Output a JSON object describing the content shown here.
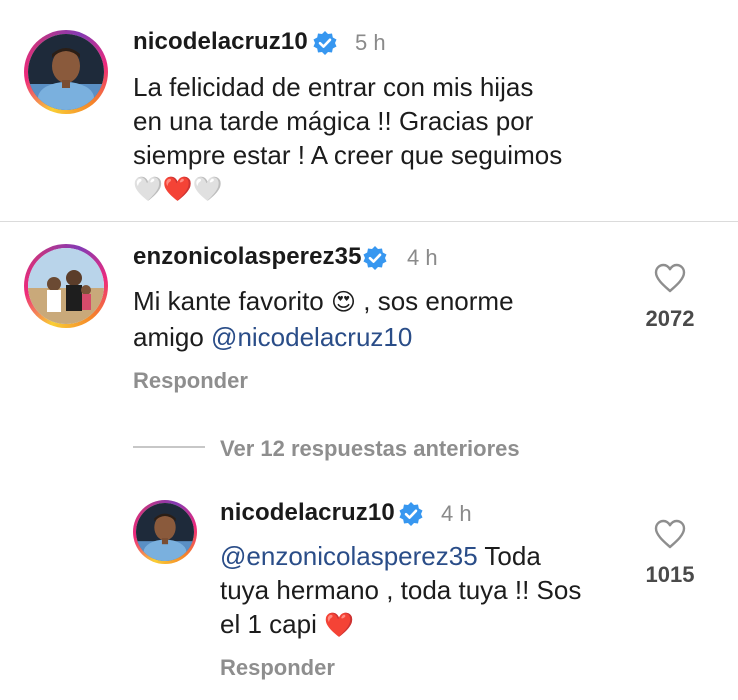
{
  "comments": [
    {
      "username": "nicodelacruz10",
      "time": "5 h",
      "lines": [
        "La felicidad de entrar con mis hijas",
        "en una tarde mágica !! Gracias por",
        "siempre estar ! A creer que seguimos"
      ],
      "emoji_line": "🤍❤️🤍"
    },
    {
      "username": "enzonicolasperez35",
      "time": "4 h",
      "line1_before": "Mi kante favorito",
      "line1_emoji": "😍",
      "line1_after": ", sos enorme",
      "line2_before": "amigo ",
      "mention": "@nicodelacruz10",
      "likes": "2072",
      "reply_label": "Responder"
    }
  ],
  "view_replies_label": "Ver 12 respuestas anteriores",
  "reply": {
    "username": "nicodelacruz10",
    "time": "4 h",
    "mention": "@enzonicolasperez35",
    "line1_after": " Toda",
    "line2": "tuya hermano , toda tuya !! Sos",
    "line3": "el 1 capi",
    "line3_emoji": "❤️",
    "likes": "1015",
    "reply_label": "Responder"
  },
  "colors": {
    "verified": "#3797f0",
    "mention": "#2a4d88",
    "muted": "#8e8e8e"
  }
}
